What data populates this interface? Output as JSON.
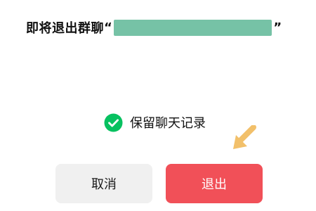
{
  "dialog": {
    "title_prefix": "即将退出群聊",
    "open_quote": "“",
    "close_quote": "”",
    "group_name_mask_color": "#76c2a6"
  },
  "options": {
    "keep_history_label": "保留聊天记录",
    "keep_history_checked": true,
    "check_color": "#07c160",
    "check_icon": "check-circle-icon"
  },
  "annotation": {
    "arrow_icon": "arrow-pointer-icon",
    "arrow_color": "#f2c06a"
  },
  "buttons": {
    "cancel_label": "取消",
    "exit_label": "退出",
    "exit_color": "#f15058"
  }
}
